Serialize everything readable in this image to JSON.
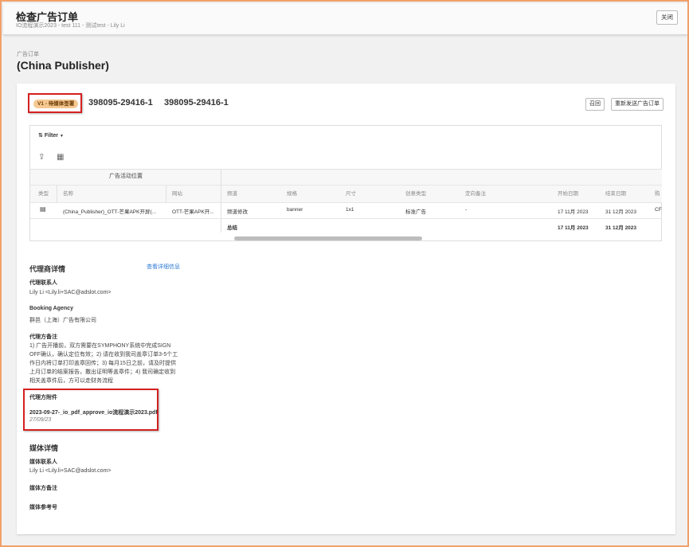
{
  "header": {
    "title": "检查广告订单",
    "subtitle": "IO流程演示2023 - test 111 - 测试test - Lily Li",
    "close_label": "关闭"
  },
  "breadcrumb": "广告订单",
  "page_title": "(China Publisher)",
  "order": {
    "status": "V1 - 待媒体签署",
    "number_1": "398095-29416-1",
    "number_2": "398095-29416-1",
    "recall_label": "召回",
    "resend_label": "重新发送广告订单"
  },
  "grid": {
    "filter_label": "Filter",
    "group_label": "广告活动位置",
    "columns": [
      "类型",
      "名称",
      "网站",
      "频道",
      "规格",
      "尺寸",
      "创意类型",
      "定向备注",
      "开始日期",
      "结束日期",
      "购"
    ],
    "row": {
      "name": "(China_Publisher)_OTT-芒果APK开屏(...",
      "site": "OTT-芒果APK开...",
      "channel": "频道修改",
      "spec": "banner",
      "size": "1x1",
      "creative_type": "标准广告",
      "targeting_note": "-",
      "start_date": "17 11月 2023",
      "end_date": "31 12月 2023",
      "overflow": "CF"
    },
    "total": {
      "label": "总结",
      "start_date": "17 11月 2023",
      "end_date": "31 12月 2023"
    }
  },
  "agency": {
    "section_title": "代理商详情",
    "view_details_link": "查看详细信息",
    "contact_label": "代理联系人",
    "contact_value": "Lily Li <Lily.li+SAC@adslot.com>",
    "booking_label": "Booking Agency",
    "booking_value": "群邑（上海）广告有限公司",
    "notes_label": "代理方备注",
    "notes_value": "1) 广告开播前，双方需要在SYMPHONY系统中完成SIGN OFF确认，确认定位有效；2) 请在收到我司盖章订单3-5个工作日内将订单打印盖章回传；3) 每月15日之前，请及时提供上月订单的结案报告，撒出证明等盖章件；4) 我司确定收到相关盖章件后，方可以走财务流程",
    "attachments_label": "代理方附件",
    "attachment_name": "2023-09-27-_io_pdf_approve_io流程演示2023.pdf",
    "attachment_date": "27/09/23"
  },
  "media": {
    "section_title": "媒体详情",
    "contact_label": "媒体联系人",
    "contact_value": "Lily Li <Lily.li+SAC@adslot.com>",
    "notes_label": "媒体方备注",
    "ref_label": "媒体参考号"
  }
}
